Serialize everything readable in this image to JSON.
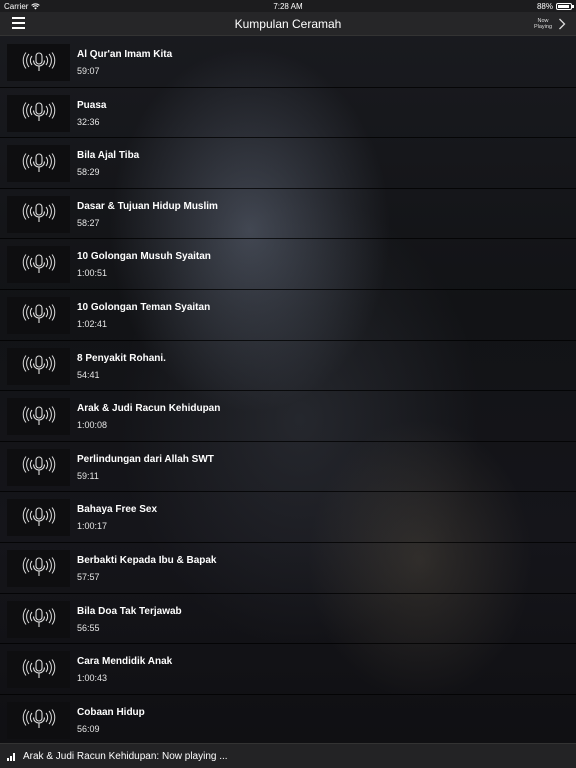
{
  "status_bar": {
    "carrier": "Carrier",
    "time": "7:28 AM",
    "battery": "88%"
  },
  "nav": {
    "title": "Kumpulan Ceramah",
    "now_playing": "Now Playing"
  },
  "items": [
    {
      "title": "Al Qur'an Imam Kita",
      "duration": "59:07"
    },
    {
      "title": "Puasa",
      "duration": "32:36"
    },
    {
      "title": "Bila Ajal Tiba",
      "duration": "58:29"
    },
    {
      "title": "Dasar & Tujuan Hidup Muslim",
      "duration": "58:27"
    },
    {
      "title": "10 Golongan Musuh Syaitan",
      "duration": "1:00:51"
    },
    {
      "title": "10 Golongan Teman Syaitan",
      "duration": "1:02:41"
    },
    {
      "title": "8 Penyakit Rohani.",
      "duration": "54:41"
    },
    {
      "title": "Arak & Judi Racun Kehidupan",
      "duration": "1:00:08"
    },
    {
      "title": "Perlindungan dari Allah SWT",
      "duration": "59:11"
    },
    {
      "title": "Bahaya Free Sex",
      "duration": "1:00:17"
    },
    {
      "title": "Berbakti Kepada Ibu & Bapak",
      "duration": "57:57"
    },
    {
      "title": "Bila Doa Tak Terjawab",
      "duration": "56:55"
    },
    {
      "title": "Cara Mendidik Anak",
      "duration": "1:00:43"
    },
    {
      "title": "Cobaan Hidup",
      "duration": "56:09"
    }
  ],
  "icons": {
    "row_thumb": "podcast-microphone-icon",
    "menu": "hamburger-menu-icon",
    "now_playing_chevron": "chevron-right-icon",
    "playing_indicator": "equalizer-icon"
  },
  "player": {
    "label": "Arak & Judi Racun Kehidupan: Now playing ..."
  }
}
